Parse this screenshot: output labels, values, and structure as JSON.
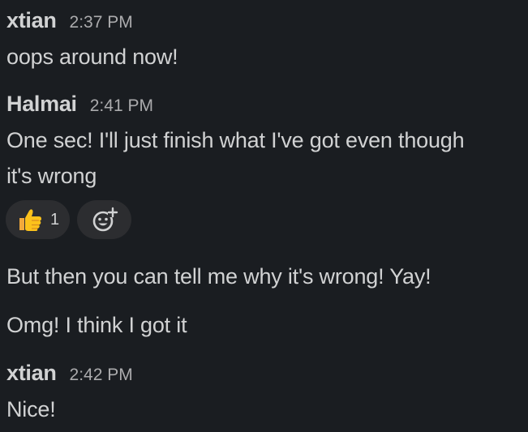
{
  "messages": [
    {
      "author": "xtian",
      "time": "2:37 PM",
      "lines": [
        "oops around now!"
      ]
    },
    {
      "author": "Halmai",
      "time": "2:41 PM",
      "lines": [
        "One sec! I'll just finish what I've got even though",
        "it's wrong"
      ],
      "reactions": [
        {
          "emoji": "thumbs-up-icon",
          "count": "1"
        }
      ],
      "followups": [
        "But then you can tell me why it's wrong! Yay!",
        "Omg! I think I got it"
      ]
    },
    {
      "author": "xtian",
      "time": "2:42 PM",
      "lines": [
        "Nice!"
      ]
    }
  ],
  "colors": {
    "background": "#1a1d21",
    "text": "#d1d2d3",
    "timestamp": "#ababad",
    "reaction_bg": "#2c2d30"
  }
}
